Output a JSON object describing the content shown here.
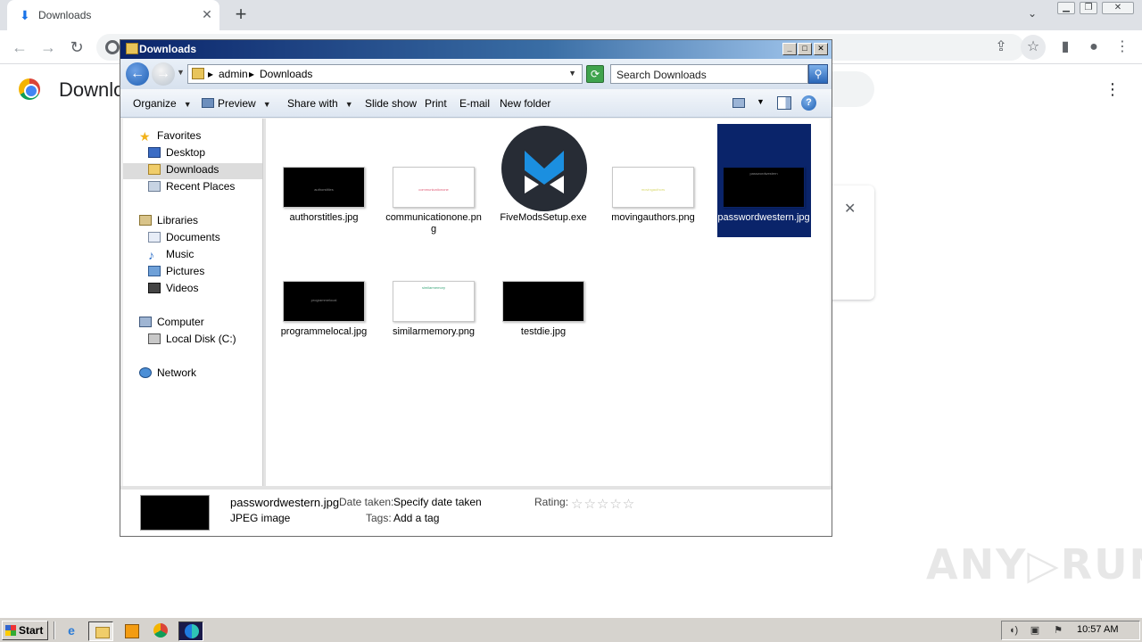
{
  "browser": {
    "tab_title": "Downloads",
    "page_heading": "Downloads",
    "icons": {
      "tab_icon": "download-arrow-icon",
      "new_tab": "plus-icon",
      "back": "arrow-left-icon",
      "forward": "arrow-right-icon",
      "reload": "reload-icon",
      "share": "share-icon",
      "bookmark": "star-icon",
      "side_panel": "side-panel-icon",
      "profile": "profile-icon",
      "menu": "kebab-menu-icon"
    }
  },
  "explorer": {
    "title": "Downloads",
    "address": {
      "segments": [
        "admin",
        "Downloads"
      ]
    },
    "search_placeholder": "Search Downloads",
    "commands": {
      "organize": "Organize",
      "preview": "Preview",
      "share_with": "Share with",
      "slide_show": "Slide show",
      "print": "Print",
      "email": "E-mail",
      "new_folder": "New folder"
    },
    "nav": {
      "favorites": "Favorites",
      "desktop": "Desktop",
      "downloads": "Downloads",
      "recent_places": "Recent Places",
      "libraries": "Libraries",
      "documents": "Documents",
      "music": "Music",
      "pictures": "Pictures",
      "videos": "Videos",
      "computer": "Computer",
      "local_disk": "Local Disk (C:)",
      "network": "Network"
    },
    "files": [
      {
        "name": "authorstitles.jpg",
        "thumb": "dark",
        "thumb_text": "authorstitles"
      },
      {
        "name": "communicationone.png",
        "thumb": "light",
        "thumb_text": "communicationone"
      },
      {
        "name": "FiveModsSetup.exe",
        "thumb": "app-logo",
        "thumb_text": ""
      },
      {
        "name": "movingauthors.png",
        "thumb": "light",
        "thumb_text": "movingauthors"
      },
      {
        "name": "passwordwestern.jpg",
        "thumb": "dark",
        "thumb_text": "passwordwestern",
        "selected": true
      },
      {
        "name": "programmelocal.jpg",
        "thumb": "dark",
        "thumb_text": "programmelocal"
      },
      {
        "name": "similarmemory.png",
        "thumb": "light",
        "thumb_text": "similarmemory"
      },
      {
        "name": "testdie.jpg",
        "thumb": "dark",
        "thumb_text": ""
      }
    ],
    "details": {
      "filename": "passwordwestern.jpg",
      "type": "JPEG image",
      "date_label": "Date taken:",
      "date_value": "Specify date taken",
      "tags_label": "Tags:",
      "tags_value": "Add a tag",
      "rating_label": "Rating:",
      "rating": 0
    }
  },
  "taskbar": {
    "start_label": "Start",
    "clock": "10:57 AM"
  },
  "colors": {
    "title_bar": "#0a246a",
    "selection": "#0a246a",
    "chrome_tabstrip": "#dee1e6"
  }
}
